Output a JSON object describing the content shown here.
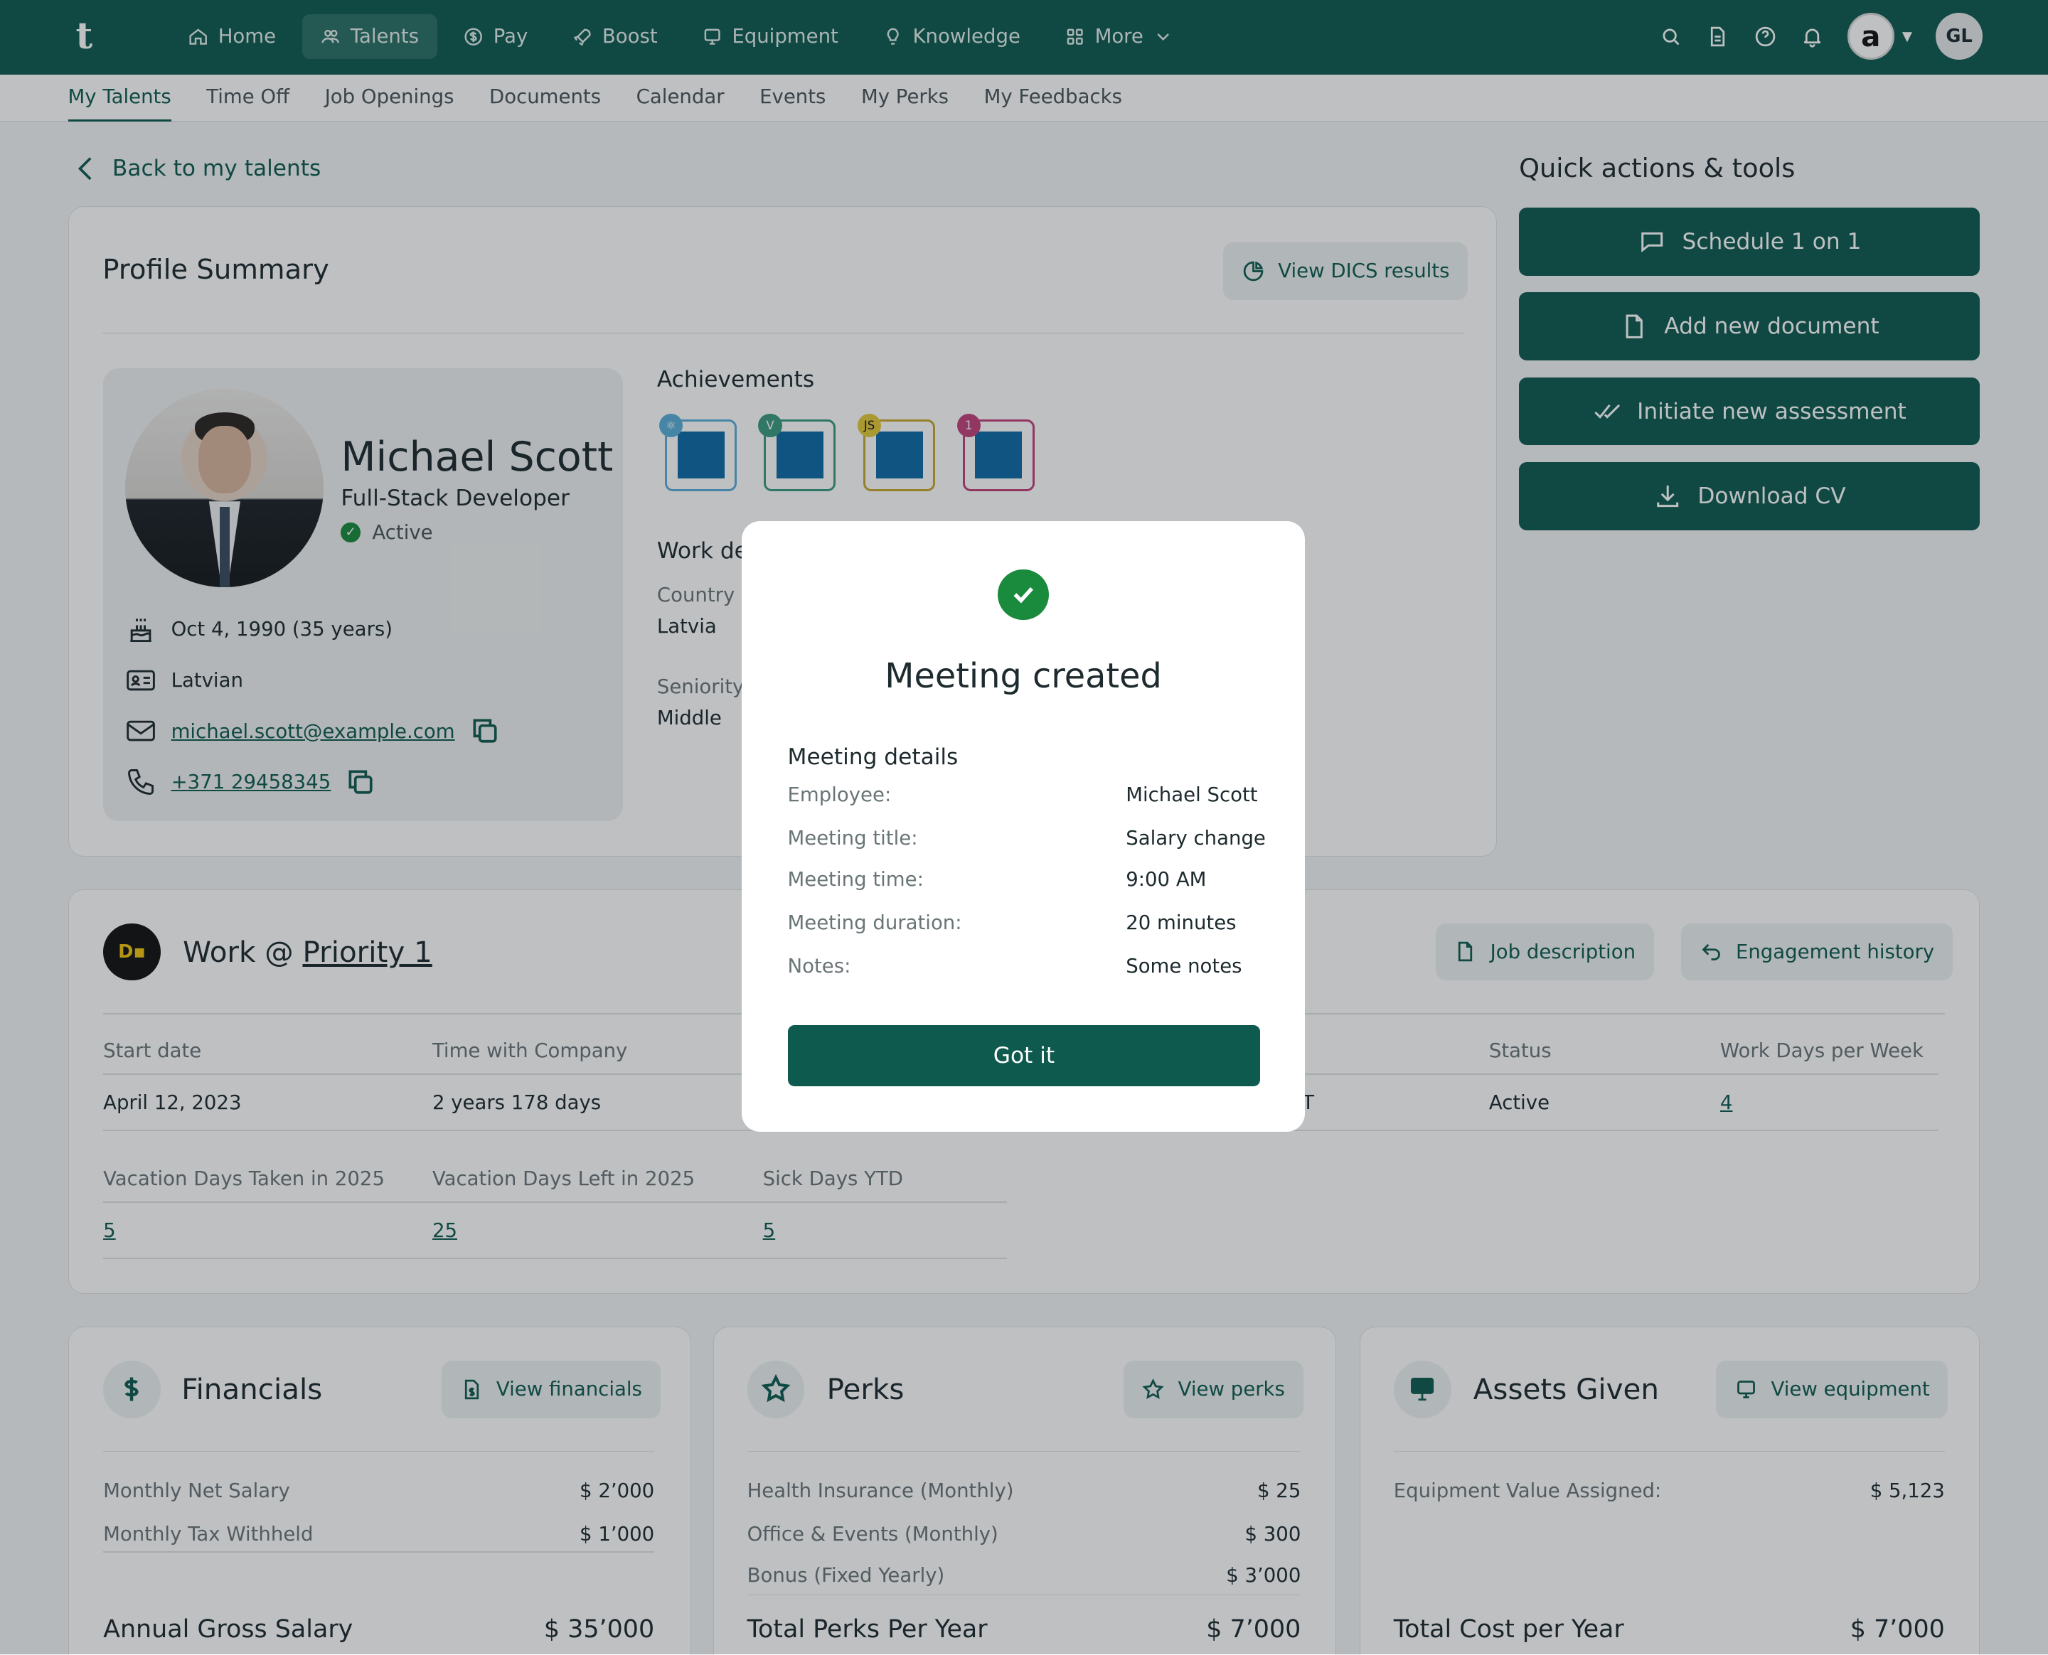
{
  "nav": {
    "logo": "t",
    "items": [
      {
        "label": "Home",
        "icon": "home-icon"
      },
      {
        "label": "Talents",
        "icon": "talents-icon"
      },
      {
        "label": "Pay",
        "icon": "dollar-icon"
      },
      {
        "label": "Boost",
        "icon": "rocket-icon"
      },
      {
        "label": "Equipment",
        "icon": "monitor-icon"
      },
      {
        "label": "Knowledge",
        "icon": "bulb-icon"
      },
      {
        "label": "More",
        "icon": "grid-icon"
      }
    ],
    "brand_avatar": "a",
    "user_initials": "GL"
  },
  "subnav": {
    "items": [
      "My Talents",
      "Time Off",
      "Job Openings",
      "Documents",
      "Calendar",
      "Events",
      "My Perks",
      "My Feedbacks"
    ]
  },
  "back_label": "Back to my talents",
  "profile": {
    "title": "Profile Summary",
    "dics_button": "View DICS results",
    "name": "Michael Scott",
    "role": "Full-Stack Developer",
    "status": "Active",
    "birthday": "Oct 4, 1990 (35 years)",
    "nationality": "Latvian",
    "email": "michael.scott@example.com",
    "phone": "+371 29458345",
    "achievements_label": "Achievements",
    "badges": [
      {
        "corner": "⚛",
        "color": "#5aaed8"
      },
      {
        "corner": "V",
        "color": "#3b9a7f"
      },
      {
        "corner": "JS",
        "color": "#c8a82c"
      },
      {
        "corner": "1",
        "color": "#c2407a"
      }
    ],
    "work_details_label": "Work de",
    "country_label": "Country",
    "country": "Latvia",
    "seniority_label": "Seniority",
    "seniority": "Middle"
  },
  "quick_actions": {
    "title": "Quick actions & tools",
    "buttons": [
      "Schedule 1 on 1",
      "Add new document",
      "Initiate new assessment",
      "Download CV"
    ]
  },
  "work": {
    "title_prefix": "Work @ ",
    "company": "Priority 1",
    "job_description": "Job description",
    "engagement_history": "Engagement history",
    "start_date_label": "Start date",
    "start_date": "April 12, 2023",
    "time_label": "Time with Company",
    "time_value": "2 years 178 days",
    "partial_value": "T",
    "status_label": "Status",
    "status_value": "Active",
    "workdays_label": "Work Days per Week",
    "workdays_value": "4",
    "vac_taken_label": "Vacation Days Taken in 2025",
    "vac_taken": "5",
    "vac_left_label": "Vacation Days Left in 2025",
    "vac_left": "25",
    "sick_label": "Sick Days YTD",
    "sick": "5"
  },
  "financials": {
    "title": "Financials",
    "button": "View financials",
    "rows": [
      {
        "label": "Monthly Net Salary",
        "value": "$ 2’000"
      },
      {
        "label": "Monthly Tax Withheld",
        "value": "$ 1’000"
      }
    ],
    "total_label": "Annual Gross Salary",
    "total_value": "$ 35’000"
  },
  "perks": {
    "title": "Perks",
    "button": "View perks",
    "rows": [
      {
        "label": "Health Insurance (Monthly)",
        "value": "$ 25"
      },
      {
        "label": "Office & Events (Monthly)",
        "value": "$ 300"
      },
      {
        "label": "Bonus (Fixed Yearly)",
        "value": "$ 3’000"
      }
    ],
    "total_label": "Total Perks Per Year",
    "total_value": "$ 7’000"
  },
  "assets": {
    "title": "Assets Given",
    "button": "View equipment",
    "rows": [
      {
        "label": "Equipment Value Assigned:",
        "value": "$ 5,123"
      }
    ],
    "total_label": "Total Cost per Year",
    "total_value": "$ 7’000"
  },
  "modal": {
    "title": "Meeting created",
    "subtitle": "Meeting details",
    "rows": [
      {
        "label": "Employee:",
        "value": "Michael Scott"
      },
      {
        "label": "Meeting title:",
        "value": "Salary change"
      },
      {
        "label": "Meeting time:",
        "value": "9:00 AM"
      },
      {
        "label": "Meeting duration:",
        "value": "20 minutes"
      },
      {
        "label": "Notes:",
        "value": "Some notes"
      }
    ],
    "button": "Got it"
  }
}
